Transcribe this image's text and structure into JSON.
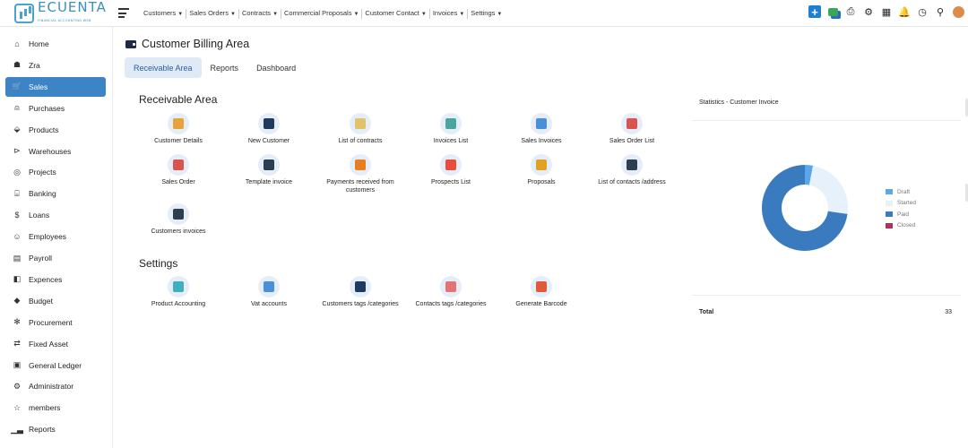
{
  "app": {
    "logo_text": "ECUENTA",
    "logo_subtitle": "FINANCIAL ACCOUNTING WEB"
  },
  "topnav": [
    {
      "label": "Customers",
      "icon": "caret-down"
    },
    {
      "label": "Sales Orders",
      "icon": "caret-down"
    },
    {
      "label": "Contracts",
      "icon": "caret-down"
    },
    {
      "label": "Commercial Proposals",
      "icon": "caret-down"
    },
    {
      "label": "Customer Contact",
      "icon": "caret-down"
    },
    {
      "label": "Invoices",
      "icon": "caret-down"
    },
    {
      "label": "Settings",
      "icon": "caret-down"
    }
  ],
  "top_icons": [
    "add-icon",
    "chat-icon",
    "printer-icon",
    "settings-icon",
    "calendar-icon",
    "bell-icon",
    "history-icon",
    "location-icon",
    "user-avatar-icon"
  ],
  "sidebar": {
    "items": [
      {
        "label": "Home",
        "icon": "home-icon",
        "active": false
      },
      {
        "label": "Zra",
        "icon": "group-icon",
        "active": false
      },
      {
        "label": "Sales",
        "icon": "cart-icon",
        "active": true
      },
      {
        "label": "Purchases",
        "icon": "bag-icon",
        "active": false
      },
      {
        "label": "Products",
        "icon": "box-icon",
        "active": false
      },
      {
        "label": "Warehouses",
        "icon": "warehouse-icon",
        "active": false
      },
      {
        "label": "Projects",
        "icon": "target-icon",
        "active": false
      },
      {
        "label": "Banking",
        "icon": "bank-icon",
        "active": false
      },
      {
        "label": "Loans",
        "icon": "dollar-icon",
        "active": false
      },
      {
        "label": "Employees",
        "icon": "employees-icon",
        "active": false
      },
      {
        "label": "Payroll",
        "icon": "payroll-icon",
        "active": false
      },
      {
        "label": "Expences",
        "icon": "expense-icon",
        "active": false
      },
      {
        "label": "Budget",
        "icon": "budget-icon",
        "active": false
      },
      {
        "label": "Procurement",
        "icon": "procurement-icon",
        "active": false
      },
      {
        "label": "Fixed Asset",
        "icon": "asset-icon",
        "active": false
      },
      {
        "label": "General Ledger",
        "icon": "ledger-icon",
        "active": false
      },
      {
        "label": "Administrator",
        "icon": "admin-icon",
        "active": false
      },
      {
        "label": "members",
        "icon": "star-icon",
        "active": false
      },
      {
        "label": "Reports",
        "icon": "chart-icon",
        "active": false
      }
    ]
  },
  "page": {
    "title": "Customer Billing Area",
    "tabs": [
      {
        "label": "Receivable Area",
        "active": true
      },
      {
        "label": "Reports",
        "active": false
      },
      {
        "label": "Dashboard",
        "active": false
      }
    ]
  },
  "receivable": {
    "title": "Receivable Area",
    "tiles": [
      {
        "label": "Customer Details",
        "icon": "customer-details-icon",
        "color": "#e8a23c"
      },
      {
        "label": "New Customer",
        "icon": "new-customer-icon",
        "color": "#1e3a5f"
      },
      {
        "label": "List of contracts",
        "icon": "contracts-icon",
        "color": "#e2c26a"
      },
      {
        "label": "Invoices List",
        "icon": "invoices-list-icon",
        "color": "#4aa5a0"
      },
      {
        "label": "Sales Invoices",
        "icon": "sales-invoices-icon",
        "color": "#4a90d9"
      },
      {
        "label": "Sales Order List",
        "icon": "sales-order-list-icon",
        "color": "#d9534f"
      },
      {
        "label": "Sales Order",
        "icon": "sales-order-icon",
        "color": "#d9534f"
      },
      {
        "label": "Template invoice",
        "icon": "template-invoice-icon",
        "color": "#2c3e50"
      },
      {
        "label": "Payments received from customers",
        "icon": "payments-icon",
        "color": "#e67e22"
      },
      {
        "label": "Prospects List",
        "icon": "prospects-icon",
        "color": "#e74c3c"
      },
      {
        "label": "Proposals",
        "icon": "proposals-icon",
        "color": "#e0a020"
      },
      {
        "label": "List of contacts /address",
        "icon": "contacts-address-icon",
        "color": "#2c3e50"
      },
      {
        "label": "Customers invoices",
        "icon": "customers-invoices-icon",
        "color": "#2c3e50"
      }
    ]
  },
  "settings": {
    "title": "Settings",
    "tiles": [
      {
        "label": "Product Accounting",
        "icon": "product-accounting-icon",
        "color": "#3db0c0"
      },
      {
        "label": "Vat accounts",
        "icon": "vat-icon",
        "color": "#4a90d9"
      },
      {
        "label": "Customers tags /categories",
        "icon": "customer-tags-icon",
        "color": "#1e3a5f"
      },
      {
        "label": "Contacts tags /categories",
        "icon": "contact-tags-icon",
        "color": "#e57373"
      },
      {
        "label": "Generate Barcode",
        "icon": "barcode-icon",
        "color": "#e05a3a"
      }
    ]
  },
  "stats": {
    "title": "Statistics - Customer Invoice",
    "total_label": "Total",
    "total_value": "33"
  },
  "chart_data": {
    "type": "pie",
    "title": "Statistics - Customer Invoice",
    "categories": [
      "Draft",
      "Started",
      "Paid",
      "Closed"
    ],
    "values": [
      1,
      8,
      24,
      0
    ],
    "colors": [
      "#5aa6e8",
      "#e6f1fb",
      "#3a7bbf",
      "#b0305a"
    ],
    "legend": "right",
    "donut": true
  }
}
